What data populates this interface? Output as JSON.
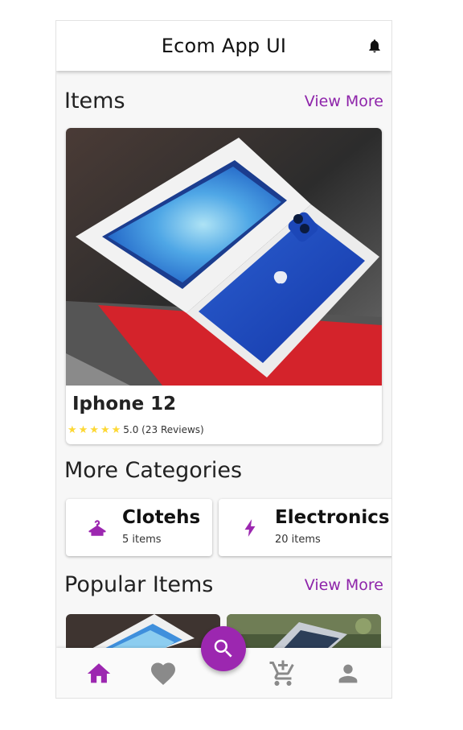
{
  "app_bar": {
    "title": "Ecom App UI",
    "bell_icon": "bell-icon"
  },
  "items_section": {
    "title": "Items",
    "view_more": "View More"
  },
  "featured_product": {
    "name": "Iphone 12",
    "rating_stars": 5,
    "rating_text": "5.0 (23 Reviews)"
  },
  "categories_section": {
    "title": "More Categories",
    "items": [
      {
        "name": "Clotehs",
        "count": "5 items",
        "icon": "hanger-icon"
      },
      {
        "name": "Electronics",
        "count": "20 items",
        "icon": "bolt-icon"
      }
    ]
  },
  "popular_section": {
    "title": "Popular Items",
    "view_more": "View More"
  },
  "bottom_nav": {
    "items": [
      {
        "name": "home",
        "icon": "home-icon",
        "active": true
      },
      {
        "name": "favorites",
        "icon": "heart-icon",
        "active": false
      },
      {
        "name": "cart",
        "icon": "cart-add-icon",
        "active": false
      },
      {
        "name": "profile",
        "icon": "person-icon",
        "active": false
      }
    ],
    "fab_icon": "search-icon"
  },
  "colors": {
    "accent": "#9c27b0",
    "accent_text": "#8e24aa",
    "star": "#fdd835",
    "nav_inactive": "#8a8a8a"
  }
}
